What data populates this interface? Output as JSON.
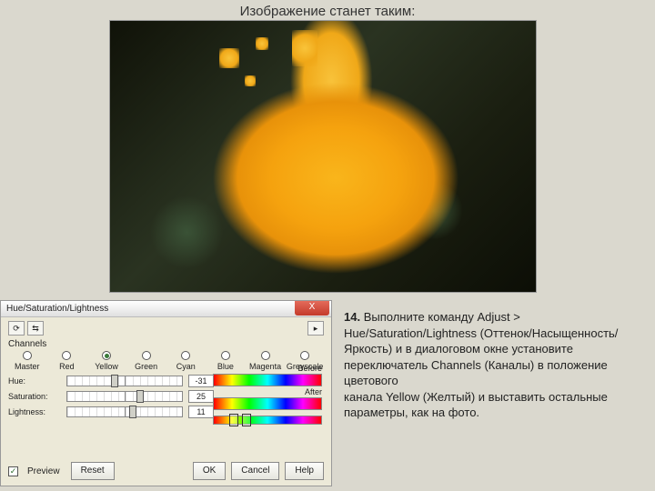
{
  "caption": "Изображение станет таким:",
  "dialog": {
    "title": "Hue/Saturation/Lightness",
    "close": "X",
    "channels_label": "Channels",
    "channels": [
      "Master",
      "Red",
      "Yellow",
      "Green",
      "Cyan",
      "Blue",
      "Magenta",
      "Greyscale"
    ],
    "channel_selected": 2,
    "sliders": {
      "hue": {
        "label": "Hue:",
        "value": "-31",
        "pos": 38
      },
      "saturation": {
        "label": "Saturation:",
        "value": "25",
        "pos": 60
      },
      "lightness": {
        "label": "Lightness:",
        "value": "11",
        "pos": 54
      }
    },
    "spectrum": {
      "before": "Before",
      "after": "After"
    },
    "buttons": {
      "preview": "Preview",
      "reset": "Reset",
      "ok": "OK",
      "cancel": "Cancel",
      "help": "Help"
    },
    "toolbar": {
      "a": "⟳",
      "b": "⇆",
      "c": "▸"
    }
  },
  "instruction": {
    "num": "14.",
    "text1": " Выполните команду Adjust > Hue/Saturation/Lightness (Оттенок/Насыщенность/Яркость) и в диалоговом окне установите",
    "text2": "переключатель Channels (Каналы) в положение цветового",
    "text3": "канала Yellow (Желтый) и выставить остальные параметры, как на фото."
  }
}
